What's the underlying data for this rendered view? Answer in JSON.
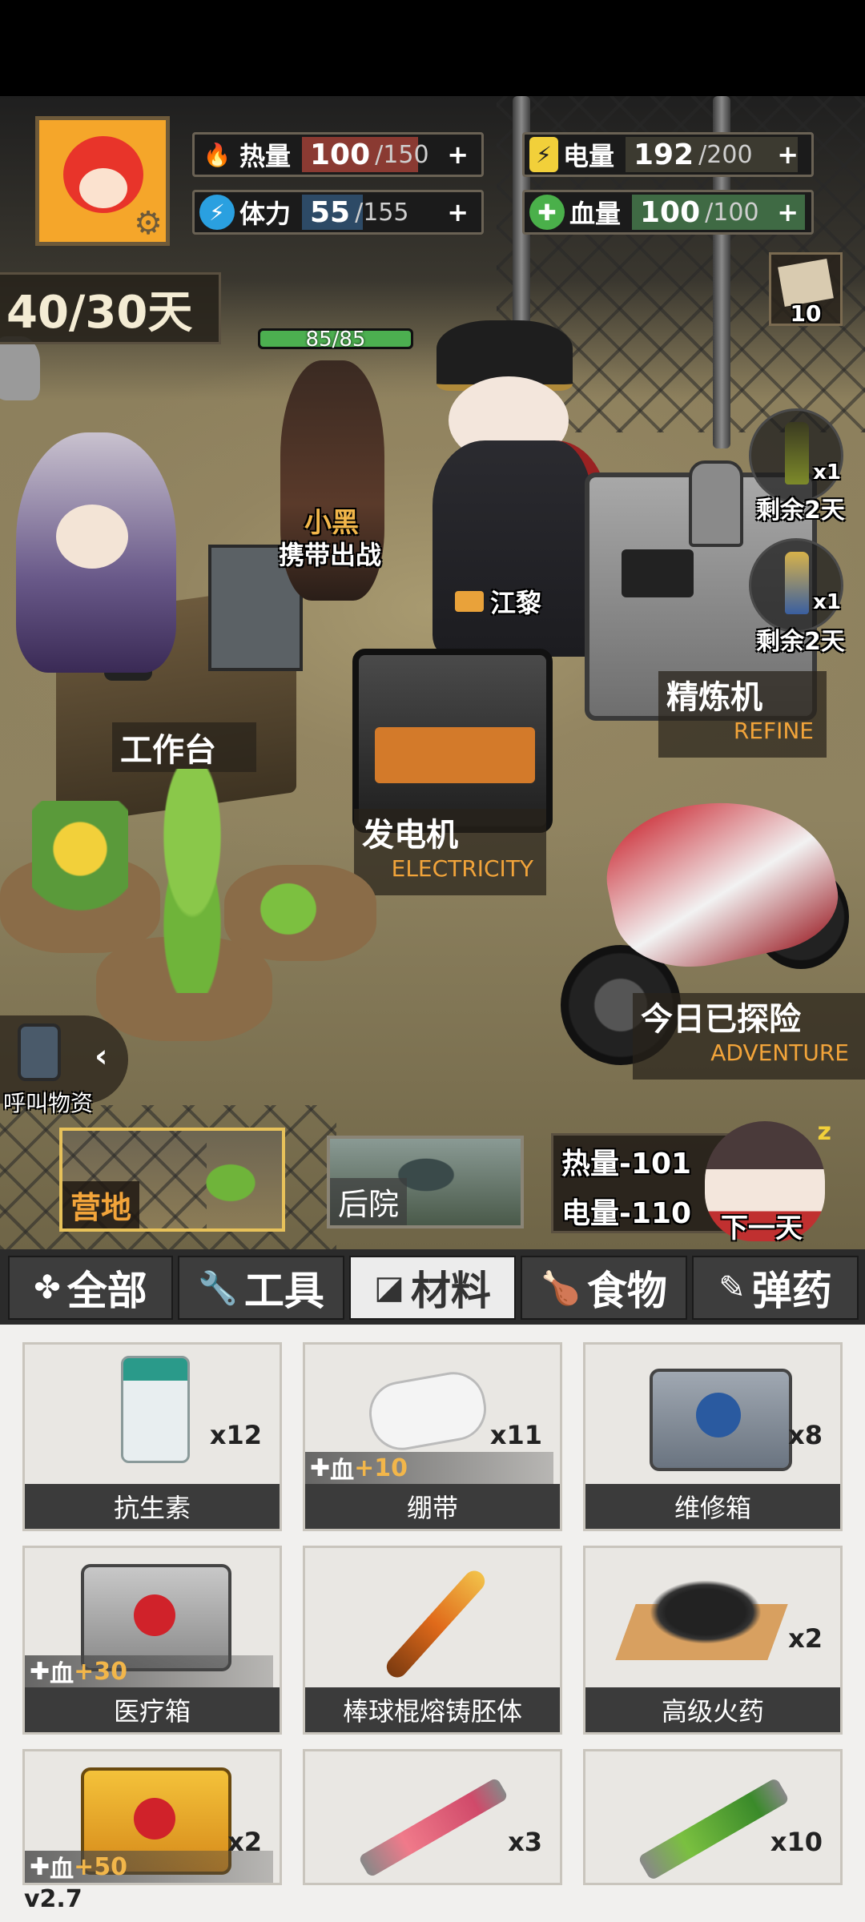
{
  "hud": {
    "stats": {
      "heat": {
        "label": "热量",
        "value": "100",
        "max": "/150",
        "plus": "+",
        "fill": 0.67
      },
      "power": {
        "label": "电量",
        "value": "192",
        "max": "/200",
        "plus": "+",
        "fill": 0.96
      },
      "stamina": {
        "label": "体力",
        "value": "55",
        "max": "/155",
        "plus": "+",
        "fill": 0.35
      },
      "blood": {
        "label": "血量",
        "value": "100",
        "max": "/100",
        "plus": "+",
        "fill": 1.0
      }
    },
    "days": "40/30天",
    "letters_count": "10"
  },
  "scene": {
    "dog": {
      "hp": "85/85",
      "hp_fill": 1.0,
      "name": "小黑",
      "action": "携带出战"
    },
    "officer": {
      "name": "江黎"
    },
    "bottles": [
      {
        "count": "x1",
        "remaining": "剩余2天"
      },
      {
        "count": "x1",
        "remaining": "剩余2天"
      }
    ],
    "workbench": {
      "cn": "工作台"
    },
    "refiner": {
      "cn": "精炼机",
      "en": "REFINE"
    },
    "generator": {
      "cn": "发电机",
      "en": "ELECTRICITY"
    },
    "motorcycle": {
      "cn": "今日已探险",
      "en": "ADVENTURE"
    },
    "call_supplies": "呼叫物资",
    "locations": [
      {
        "label": "营地",
        "active": true
      },
      {
        "label": "后院",
        "active": false
      }
    ],
    "next_day": {
      "heat": "热量-101",
      "power": "电量-110",
      "button": "下一天"
    }
  },
  "categories": [
    {
      "icon": "✤",
      "label": "全部",
      "active": false
    },
    {
      "icon": "🔧",
      "label": "工具",
      "active": false
    },
    {
      "icon": "◪",
      "label": "材料",
      "active": true
    },
    {
      "icon": "🍗",
      "label": "食物",
      "active": false
    },
    {
      "icon": "✎",
      "label": "弹药",
      "active": false
    }
  ],
  "items": [
    {
      "name": "抗生素",
      "qty": "x12",
      "hp": ""
    },
    {
      "name": "绷带",
      "qty": "x11",
      "hp": "+10",
      "hp_label": "血"
    },
    {
      "name": "维修箱",
      "qty": "x8",
      "hp": ""
    },
    {
      "name": "医疗箱",
      "qty": "",
      "hp": "+30",
      "hp_label": "血"
    },
    {
      "name": "棒球棍熔铸胚体",
      "qty": "",
      "hp": ""
    },
    {
      "name": "高级火药",
      "qty": "x2",
      "hp": ""
    },
    {
      "name": "",
      "qty": "x2",
      "hp": "+50",
      "hp_label": "血"
    },
    {
      "name": "",
      "qty": "x3",
      "hp": ""
    },
    {
      "name": "",
      "qty": "x10",
      "hp": ""
    }
  ],
  "version": "v2.7",
  "colors": {
    "heat_fill": "#8a3a32",
    "power_fill": "#3c3a30",
    "stamina_fill": "#2d4a66",
    "blood_fill": "#3f6a44",
    "accent_orange": "#f2a43a",
    "active_border": "#e8c25a"
  },
  "icons": {
    "heat": "flame-icon",
    "power": "battery-icon",
    "stamina": "lightning-icon",
    "blood": "blood-drop-icon"
  }
}
